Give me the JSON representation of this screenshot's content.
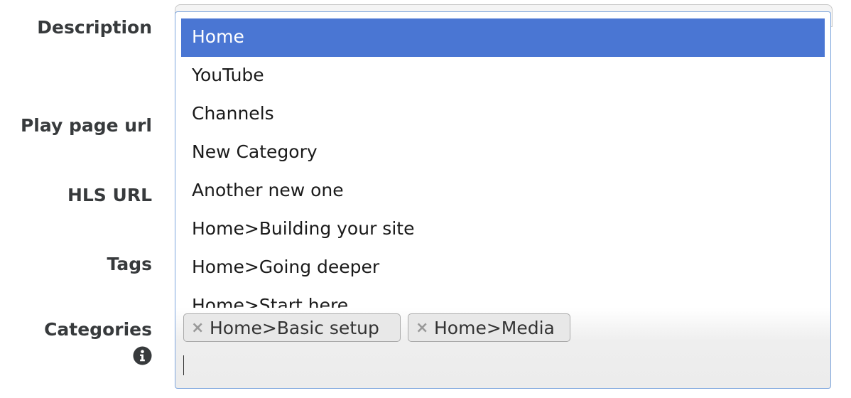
{
  "form": {
    "labels": {
      "description": "Description",
      "play_page_url": "Play page url",
      "hls_url": "HLS URL",
      "tags": "Tags",
      "categories": "Categories"
    }
  },
  "dropdown": {
    "options": [
      {
        "label": "Home",
        "highlighted": true
      },
      {
        "label": "YouTube",
        "highlighted": false
      },
      {
        "label": "Channels",
        "highlighted": false
      },
      {
        "label": "New Category",
        "highlighted": false
      },
      {
        "label": "Another new one",
        "highlighted": false
      },
      {
        "label": "Home>Building your site",
        "highlighted": false
      },
      {
        "label": "Home>Going deeper",
        "highlighted": false
      },
      {
        "label": "Home>Start here",
        "highlighted": false
      }
    ]
  },
  "selection": {
    "chips": [
      {
        "remove_glyph": "×",
        "label": "Home>Basic setup"
      },
      {
        "remove_glyph": "×",
        "label": "Home>Media"
      }
    ],
    "search_value": ""
  },
  "colors": {
    "highlight": "#4a76d3",
    "focus_border": "#7ea6dd",
    "label_text": "#373a3c"
  },
  "icons": {
    "categories_help": "info-circle-icon",
    "chip_remove": "close-icon"
  }
}
